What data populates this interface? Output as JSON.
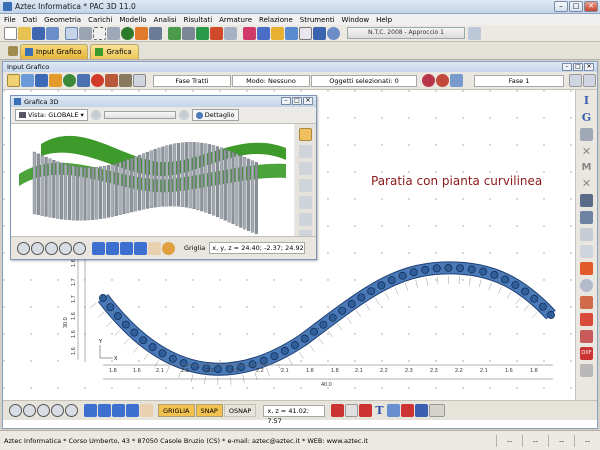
{
  "app": {
    "title": "Aztec Informatica * PAC 3D 11.0"
  },
  "menu": [
    "File",
    "Dati",
    "Geometria",
    "Carichi",
    "Modello",
    "Analisi",
    "Risultati",
    "Armature",
    "Relazione",
    "Strumenti",
    "Window",
    "Help"
  ],
  "toolbar": {
    "ntc_label": "N.T.C. 2008 - Approccio 1"
  },
  "tabs": [
    {
      "label": "Input Grafico"
    },
    {
      "label": "Grafica"
    }
  ],
  "input_grafico": {
    "title": "Input Grafico",
    "fase_tratti": "Fase Tratti",
    "modo": "Modo: Nessuno",
    "oggetti": "Oggetti selezionati: 0",
    "fase": "Fase 1"
  },
  "canvas": {
    "heading": "Paratia con pianta curvilinea",
    "dim_labels_bottom": [
      "1.8",
      "1.6",
      "2.1",
      "2.2",
      "2.3",
      "2.3",
      "2.2",
      "2.1",
      "1.8",
      "1.8",
      "2.1",
      "2.2",
      "2.3",
      "2.3",
      "2.2",
      "2.1",
      "1.6",
      "1.8"
    ],
    "total_width": "40.0",
    "left_dims": [
      "1.6",
      "1.7",
      "1.7",
      "1.6",
      "1.6",
      "1.6",
      "1.7",
      "1.7"
    ],
    "left_total": "30.0",
    "axis_x": "X",
    "axis_y": "Y"
  },
  "bottom": {
    "griglia": "GRIGLIA",
    "snap": "SNAP",
    "osnap": "OSNAP",
    "coords": "x, z = 41.02; 7.57"
  },
  "grafica3d": {
    "title": "Grafica 3D",
    "vista": "Vista: GLOBALE",
    "dettaglio": "Dettaglio",
    "griglia": "Griglia",
    "coords": "x, y, z = 24.40; -2.37; 24.92"
  },
  "status": {
    "text": "Aztec Informatica * Corso Umberto, 43 * 87050 Casole Bruzio (CS) * e-mail: aztec@aztec.it * WEB: www.aztec.it",
    "cells": [
      "--",
      "--",
      "--",
      "--"
    ]
  },
  "colors": {
    "beam_fill": "#4a7ab8",
    "pile_fill": "#3c6aa8",
    "heading": "#8a1b1b",
    "terrain": "#3f9a2c"
  }
}
